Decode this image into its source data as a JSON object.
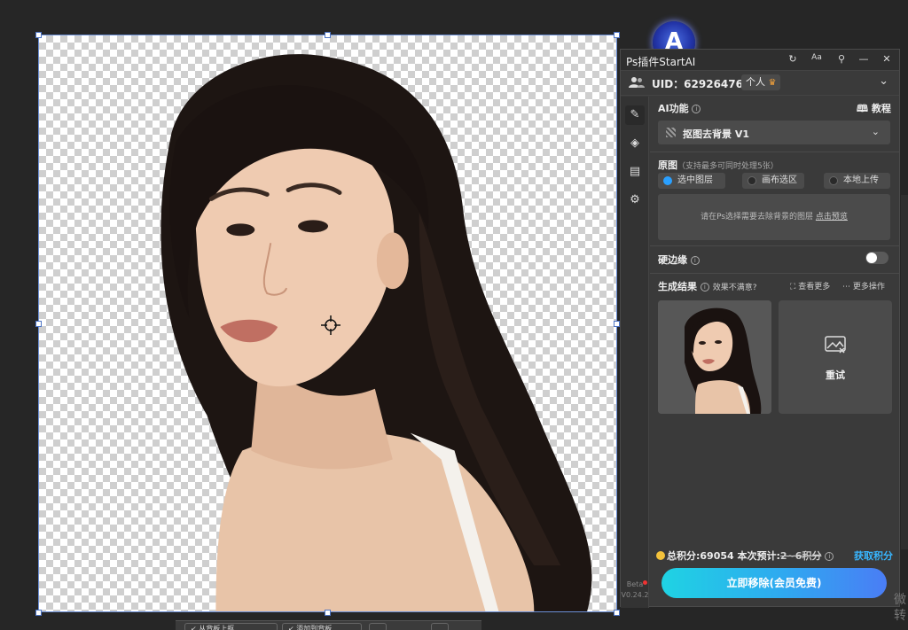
{
  "panel": {
    "title": "Ps插件StartAI",
    "title_controls": [
      "↻",
      "Aa",
      "⚲",
      "—",
      "✕"
    ],
    "uid": "UID：629264764",
    "account_type": "个人",
    "account_badge_icon": "crown-icon",
    "ai_function_label": "AI功能",
    "tutorial_label": "教程",
    "selected_function": "抠图去背景 V1",
    "source_label": "原图",
    "source_note": "（支持最多可同时处理5张）",
    "source_options": [
      {
        "label": "选中图层",
        "selected": true
      },
      {
        "label": "画布选区",
        "selected": false
      },
      {
        "label": "本地上传",
        "selected": false
      }
    ],
    "hint_text": "请在Ps选择需要去除背景的图层",
    "hint_link": "点击预览",
    "hard_edge_label": "硬边缘",
    "hard_edge_on": false,
    "results_label": "生成结果",
    "results_feedback": "效果不满意?",
    "view_more": "查看更多",
    "more_actions": "更多操作",
    "retry_label": "重试",
    "total_points_label": "总积分:69054",
    "estimate_label": "本次预计:",
    "estimate_value": "2~6积分",
    "get_points": "获取积分",
    "remove_button": "立即移除(会员免费)",
    "version_beta": "Beta",
    "version": "V0.24.2"
  },
  "logo_letter": "A",
  "bottom_bar": [
    "↙ 从背板上抠",
    "↙ 添加到背板",
    "",
    ""
  ],
  "watermark": "微转",
  "colors": {
    "accent": "#2aa0ff",
    "button_gradient_start": "#1fd3e3",
    "button_gradient_end": "#4a7df5",
    "link": "#38b6ff",
    "coin": "#f3c23b"
  }
}
